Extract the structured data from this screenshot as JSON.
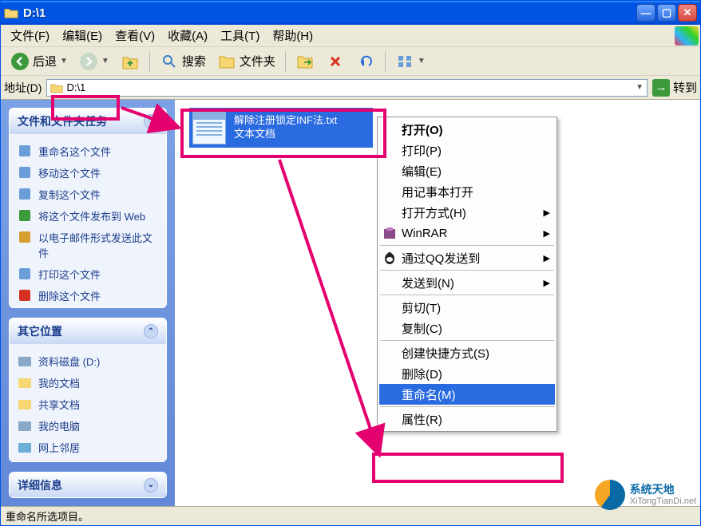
{
  "title": "D:\\1",
  "menus": [
    "文件(F)",
    "编辑(E)",
    "查看(V)",
    "收藏(A)",
    "工具(T)",
    "帮助(H)"
  ],
  "toolbar": {
    "back": "后退",
    "search": "搜索",
    "folders": "文件夹"
  },
  "addrbar": {
    "label": "地址(D)",
    "path": "D:\\1",
    "go": "转到"
  },
  "panels": {
    "tasks": {
      "title": "文件和文件夹任务",
      "items": [
        "重命名这个文件",
        "移动这个文件",
        "复制这个文件",
        "将这个文件发布到 Web",
        "以电子邮件形式发送此文件",
        "打印这个文件",
        "删除这个文件"
      ]
    },
    "places": {
      "title": "其它位置",
      "items": [
        "资料磁盘 (D:)",
        "我的文档",
        "共享文档",
        "我的电脑",
        "网上邻居"
      ]
    },
    "details": {
      "title": "详细信息"
    }
  },
  "file": {
    "name": "解除注册锁定INF法.txt",
    "type": "文本文档"
  },
  "context_menu": [
    {
      "label": "打开(O)",
      "bold": true
    },
    {
      "label": "打印(P)"
    },
    {
      "label": "编辑(E)"
    },
    {
      "label": "用记事本打开"
    },
    {
      "label": "打开方式(H)",
      "submenu": true
    },
    {
      "label": "WinRAR",
      "icon": "winrar-icon",
      "submenu": true
    },
    {
      "sep": true
    },
    {
      "label": "通过QQ发送到",
      "icon": "qq-icon",
      "submenu": true
    },
    {
      "sep": true
    },
    {
      "label": "发送到(N)",
      "submenu": true
    },
    {
      "sep": true
    },
    {
      "label": "剪切(T)"
    },
    {
      "label": "复制(C)"
    },
    {
      "sep": true
    },
    {
      "label": "创建快捷方式(S)"
    },
    {
      "label": "删除(D)"
    },
    {
      "label": "重命名(M)",
      "selected": true
    },
    {
      "sep": true
    },
    {
      "label": "属性(R)"
    }
  ],
  "statusbar": "重命名所选项目。",
  "watermark": {
    "name": "系统天地",
    "url": "XiTongTianDi.net"
  },
  "colors": {
    "accent": "#e4006e",
    "selection": "#2a6be0",
    "titlebar": "#0054e3"
  }
}
